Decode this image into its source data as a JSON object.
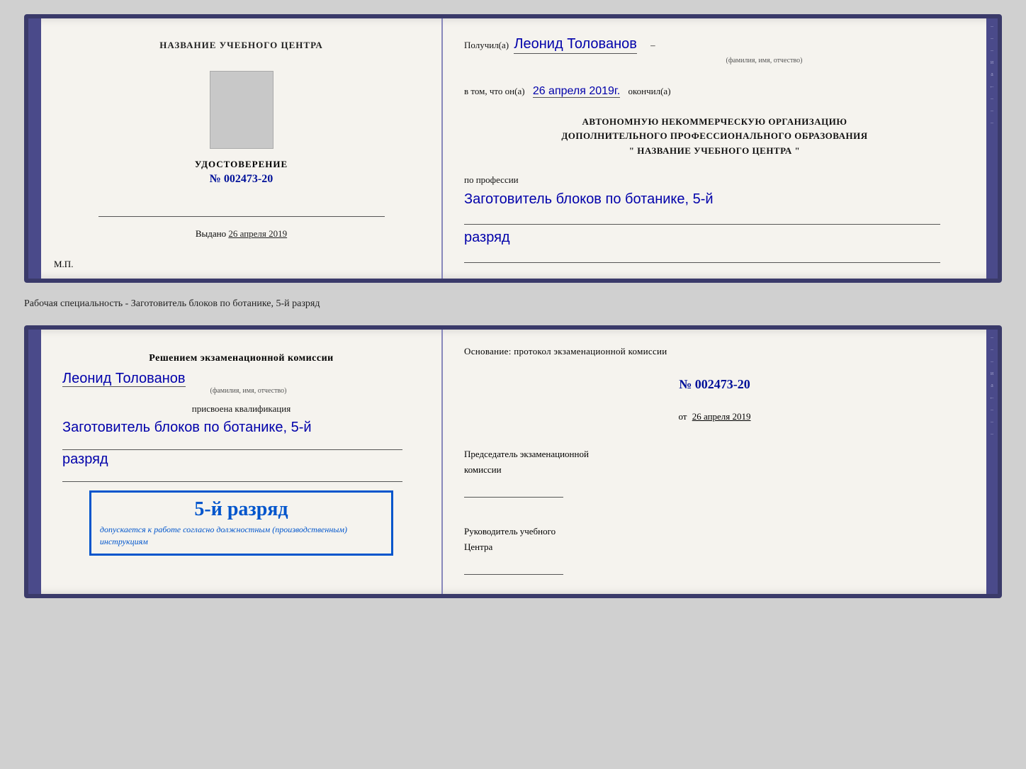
{
  "card1": {
    "left": {
      "section_title": "НАЗВАНИЕ УЧЕБНОГО ЦЕНТРА",
      "udost_label": "УДОСТОВЕРЕНИЕ",
      "udost_number": "№ 002473-20",
      "vydano_label": "Выдано",
      "vydano_date": "26 апреля 2019",
      "mp_label": "М.П."
    },
    "right": {
      "poluchil_label": "Получил(а)",
      "poluchil_name": "Леонид Толованов",
      "fio_label": "(фамилия, имя, отчество)",
      "vtom_label": "в том, что он(а)",
      "vtom_date": "26 апреля 2019г.",
      "okonchil_label": "окончил(а)",
      "org_line1": "АВТОНОМНУЮ НЕКОММЕРЧЕСКУЮ ОРГАНИЗАЦИЮ",
      "org_line2": "ДОПОЛНИТЕЛЬНОГО ПРОФЕССИОНАЛЬНОГО ОБРАЗОВАНИЯ",
      "org_name": "\"   НАЗВАНИЕ УЧЕБНОГО ЦЕНТРА   \"",
      "po_professii_label": "по профессии",
      "profession_text": "Заготовитель блоков по ботанике, 5-й",
      "razryad_text": "разряд"
    }
  },
  "separator": {
    "text": "Рабочая специальность - Заготовитель блоков по ботанике, 5-й разряд"
  },
  "card2": {
    "left": {
      "title_line1": "Решением экзаменационной комиссии",
      "person_name": "Леонид Толованов",
      "fio_label": "(фамилия, имя, отчество)",
      "prisvoena_label": "присвоена квалификация",
      "qualification_text": "Заготовитель блоков по ботанике, 5-й",
      "razryad_text": "разряд",
      "stamp_grade": "5-й разряд",
      "dopuskaetsya_label": "допускается к",
      "dopuskaetsya_text": "работе согласно должностным (производственным) инструкциям"
    },
    "right": {
      "osnovanie_label": "Основание: протокол экзаменационной комиссии",
      "protocol_number": "№  002473-20",
      "ot_label": "от",
      "ot_date": "26 апреля 2019",
      "predsedatel_line1": "Председатель экзаменационной",
      "predsedatel_line2": "комиссии",
      "rukovoditel_line1": "Руководитель учебного",
      "rukovoditel_line2": "Центра"
    }
  }
}
